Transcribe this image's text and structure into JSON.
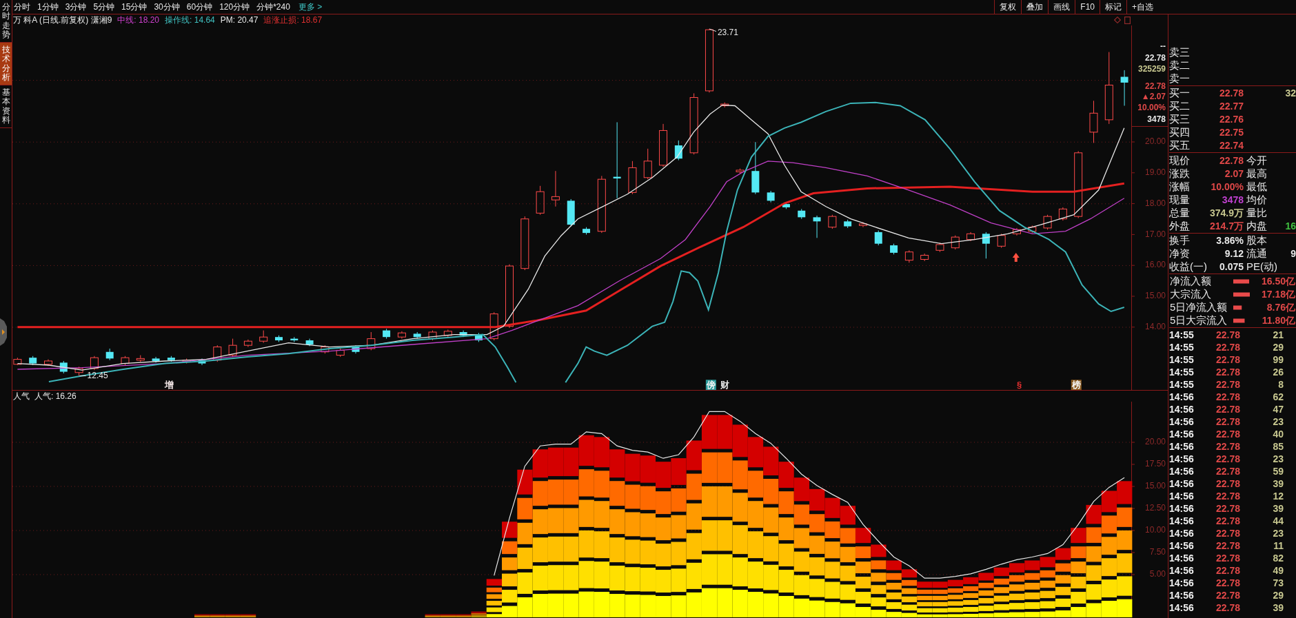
{
  "sidebar": {
    "tabs": [
      {
        "label": "分时走势",
        "selected": false
      },
      {
        "label": "技术分析",
        "selected": true
      },
      {
        "label": "基本资料",
        "selected": false
      }
    ]
  },
  "toolbar": {
    "periods": [
      "分时",
      "1分钟",
      "3分钟",
      "5分钟",
      "15分钟",
      "30分钟",
      "60分钟",
      "120分钟",
      "分钟*240"
    ],
    "more": "更多 >",
    "buttons": [
      "复权",
      "叠加",
      "画线",
      "F10",
      "标记",
      "+自选"
    ]
  },
  "main_chart": {
    "title": "万 科A (日线.前复权) 潇湘9",
    "indicators": [
      {
        "label": "中线: 18.20",
        "color": "#d040d0"
      },
      {
        "label": "操作线: 14.64",
        "color": "#40c0c0"
      },
      {
        "label": "PM: 20.47",
        "color": "#e8e8e8"
      },
      {
        "label": "追涨止损: 18.67",
        "color": "#e03030"
      }
    ],
    "high_label": "23.71",
    "low_label": "12.45",
    "axis_quote": [
      {
        "text": "--",
        "color": "#e8e8e8"
      },
      {
        "text": "22.78",
        "color": "#e8e8e8"
      },
      {
        "text": "325259",
        "color": "#c8c890"
      },
      {
        "text": "22.78",
        "color": "#e04848"
      },
      {
        "text": "▲2.07",
        "color": "#e04848"
      },
      {
        "text": "10.00%",
        "color": "#e04848"
      },
      {
        "text": "3478",
        "color": "#e8e8e8"
      }
    ],
    "price_axis": [
      "20.00",
      "19.00",
      "18.00",
      "17.00",
      "16.00",
      "15.00",
      "14.00"
    ],
    "signals": [
      {
        "text": "增",
        "kind": "plain",
        "color": "#f0e4e4"
      },
      {
        "text": "傍",
        "kind": "boxed",
        "color": "#2a9a9a"
      },
      {
        "text": "财",
        "kind": "plain",
        "color": "#e8e8e8"
      },
      {
        "text": "§",
        "kind": "plain",
        "color": "#e83030"
      },
      {
        "text": "榜",
        "kind": "boxed",
        "color": "#8a5a20"
      }
    ]
  },
  "sub_chart": {
    "title": "人气",
    "reading": "人气: 16.26",
    "axis": [
      "20.00",
      "17.50",
      "15.00",
      "12.50",
      "10.00",
      "7.50",
      "5.00"
    ]
  },
  "order_book": {
    "asks": [
      {
        "label": "卖三"
      },
      {
        "label": "卖二"
      },
      {
        "label": "卖一"
      }
    ],
    "bids": [
      {
        "label": "买一",
        "price": "22.78",
        "volume": "32"
      },
      {
        "label": "买二",
        "price": "22.77"
      },
      {
        "label": "买三",
        "price": "22.76"
      },
      {
        "label": "买四",
        "price": "22.75"
      },
      {
        "label": "买五",
        "price": "22.74"
      }
    ]
  },
  "quote": [
    {
      "label": "现价",
      "value": "22.78",
      "color": "#e04848",
      "right": {
        "label": "今开"
      }
    },
    {
      "label": "涨跌",
      "value": "2.07",
      "color": "#e04848",
      "right": {
        "label": "最高"
      }
    },
    {
      "label": "涨幅",
      "value": "10.00%",
      "color": "#e04848",
      "right": {
        "label": "最低"
      }
    },
    {
      "label": "现量",
      "value": "3478",
      "color": "#c040d0",
      "right": {
        "label": "均价"
      }
    },
    {
      "label": "总量",
      "value": "374.9万",
      "color": "#c8c890",
      "right": {
        "label": "量比"
      }
    },
    {
      "label": "外盘",
      "value": "214.7万",
      "color": "#e04848",
      "right": {
        "label": "内盘",
        "value": "16",
        "color": "#40c040"
      }
    }
  ],
  "fundamentals": [
    {
      "label": "换手",
      "value": "3.86%",
      "right": {
        "label": "股本"
      }
    },
    {
      "label": "净资",
      "value": "9.12",
      "right": {
        "label": "流通",
        "value": "9"
      }
    },
    {
      "label": "收益(一)",
      "value": "0.075",
      "right": {
        "label": "PE(动)"
      }
    }
  ],
  "fund_flow": {
    "chart_data": {
      "type": "bar",
      "orientation": "horizontal",
      "categories": [
        "净流入额",
        "大宗流入",
        "5日净流入额",
        "5日大宗流入"
      ],
      "values": [
        16.5,
        17.18,
        8.76,
        11.8
      ],
      "value_labels": [
        "16.50亿",
        "17.18亿",
        "8.76亿",
        "11.80亿"
      ]
    }
  },
  "trades": [
    {
      "time": "14:55",
      "price": "22.78",
      "volume": "21"
    },
    {
      "time": "14:55",
      "price": "22.78",
      "volume": "29"
    },
    {
      "time": "14:55",
      "price": "22.78",
      "volume": "99"
    },
    {
      "time": "14:55",
      "price": "22.78",
      "volume": "26"
    },
    {
      "time": "14:55",
      "price": "22.78",
      "volume": "8"
    },
    {
      "time": "14:56",
      "price": "22.78",
      "volume": "62"
    },
    {
      "time": "14:56",
      "price": "22.78",
      "volume": "47"
    },
    {
      "time": "14:56",
      "price": "22.78",
      "volume": "23"
    },
    {
      "time": "14:56",
      "price": "22.78",
      "volume": "40"
    },
    {
      "time": "14:56",
      "price": "22.78",
      "volume": "85"
    },
    {
      "time": "14:56",
      "price": "22.78",
      "volume": "23"
    },
    {
      "time": "14:56",
      "price": "22.78",
      "volume": "59"
    },
    {
      "time": "14:56",
      "price": "22.78",
      "volume": "39"
    },
    {
      "time": "14:56",
      "price": "22.78",
      "volume": "12"
    },
    {
      "time": "14:56",
      "price": "22.78",
      "volume": "39"
    },
    {
      "time": "14:56",
      "price": "22.78",
      "volume": "44"
    },
    {
      "time": "14:56",
      "price": "22.78",
      "volume": "23"
    },
    {
      "time": "14:56",
      "price": "22.78",
      "volume": "11"
    },
    {
      "time": "14:56",
      "price": "22.78",
      "volume": "82"
    },
    {
      "time": "14:56",
      "price": "22.78",
      "volume": "49"
    },
    {
      "time": "14:56",
      "price": "22.78",
      "volume": "73"
    },
    {
      "time": "14:56",
      "price": "22.78",
      "volume": "29"
    },
    {
      "time": "14:56",
      "price": "22.78",
      "volume": "39"
    }
  ]
}
